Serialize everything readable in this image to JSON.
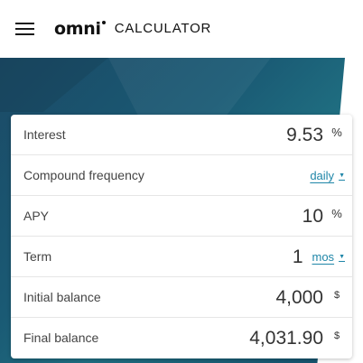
{
  "header": {
    "logo_mark": "omni",
    "logo_text": "CALCULATOR"
  },
  "calculator": {
    "rows": [
      {
        "label": "Interest",
        "value": "9.53",
        "unit": "%"
      },
      {
        "label": "Compound frequency",
        "select": "daily"
      },
      {
        "label": "APY",
        "value": "10",
        "unit": "%"
      },
      {
        "label": "Term",
        "value": "1",
        "select": "mos"
      },
      {
        "label": "Initial balance",
        "value": "4,000",
        "unit": "$"
      },
      {
        "label": "Final balance",
        "value": "4,031.90",
        "unit": "$"
      }
    ]
  },
  "colors": {
    "banner": "#1a5a74",
    "link": "#1f86a8",
    "text": "#333333"
  },
  "icons": {
    "menu": "hamburger-menu-icon",
    "caret": "caret-down-icon"
  }
}
